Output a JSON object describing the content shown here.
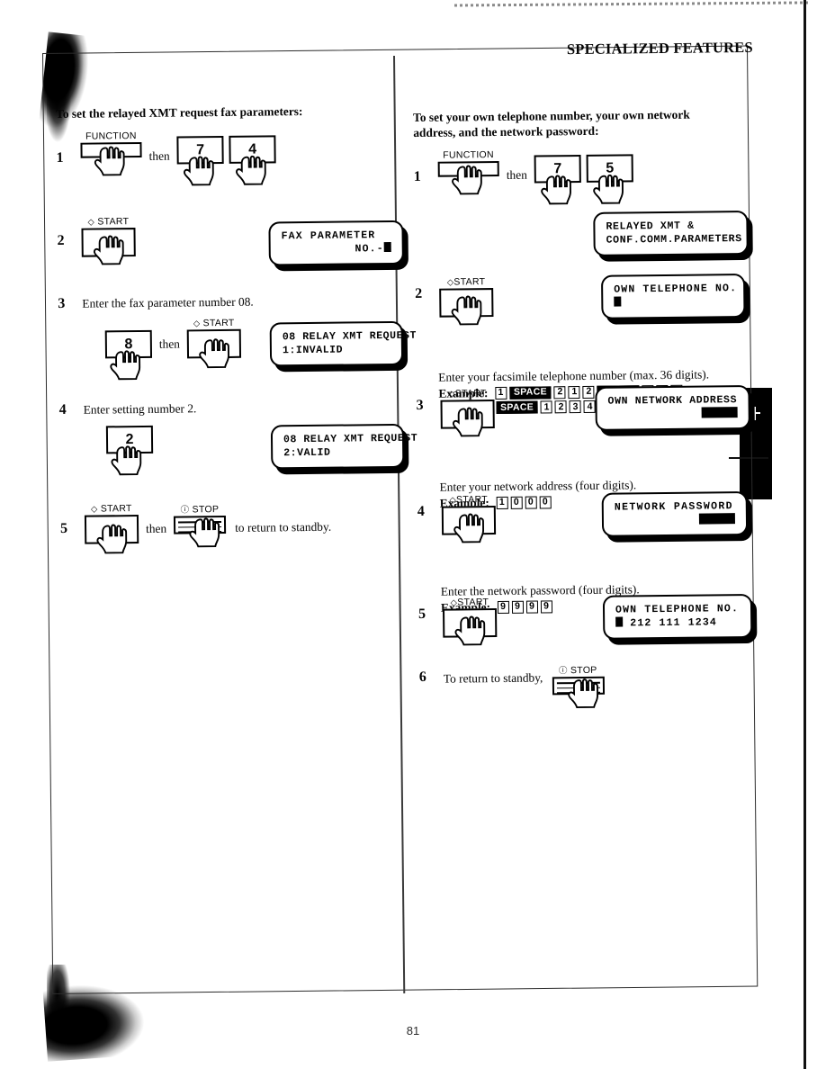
{
  "header": {
    "title": "SPECIALIZED FEATURES"
  },
  "footer": {
    "page_number": "81"
  },
  "left_column": {
    "intro": "To set the relayed XMT request fax parameters:",
    "steps": [
      {
        "num": "1",
        "keys": [
          {
            "cap": "FUNCTION",
            "label": ""
          },
          {
            "cap": "",
            "label": "7"
          },
          {
            "cap": "",
            "label": "4"
          }
        ],
        "then_label": "then"
      },
      {
        "num": "2",
        "start_cap": "START",
        "display": {
          "line1": "FAX PARAMETER",
          "line2": "NO.-"
        }
      },
      {
        "num": "3",
        "text": "Enter the fax parameter number 08.",
        "digit": "8",
        "then_label": "then",
        "start_cap": "START",
        "display": {
          "line1": "08 RELAY XMT REQUEST",
          "line2": "1:INVALID"
        }
      },
      {
        "num": "4",
        "text": "Enter setting number 2.",
        "digit": "2",
        "display": {
          "line1": "08 RELAY XMT REQUEST",
          "line2": "2:VALID"
        }
      },
      {
        "num": "5",
        "start_cap": "START",
        "then_label": "then",
        "stop_cap": "STOP",
        "trailing_text": "to return to standby."
      }
    ]
  },
  "right_column": {
    "intro": "To set your own telephone number, your own network address, and the network password:",
    "steps": [
      {
        "num": "1",
        "keys": [
          {
            "cap": "FUNCTION",
            "label": ""
          },
          {
            "cap": "",
            "label": "7"
          },
          {
            "cap": "",
            "label": "5"
          }
        ],
        "then_label": "then",
        "display": {
          "line1": "RELAYED XMT &",
          "line2": "CONF.COMM.PARAMETERS"
        }
      },
      {
        "num": "2",
        "start_cap": "START",
        "display": {
          "line1": "OWN TELEPHONE NO.",
          "line2": ""
        },
        "text": "Enter your facsimile telephone number (max. 36 digits).",
        "example_label": "Example:",
        "example_keys_row1": [
          "1",
          "SPACE",
          "2",
          "1",
          "2",
          "SPACE",
          "1",
          "1",
          "1"
        ],
        "example_keys_row2": [
          "SPACE",
          "1",
          "2",
          "3",
          "4"
        ]
      },
      {
        "num": "3",
        "start_cap": "START",
        "display": {
          "line1": "OWN NETWORK ADDRESS",
          "line2": ""
        },
        "text": "Enter your network address (four digits).",
        "example_label": "Example:",
        "example_keys_row1": [
          "1",
          "0",
          "0",
          "0"
        ]
      },
      {
        "num": "4",
        "start_cap": "START",
        "display": {
          "line1": "NETWORK PASSWORD",
          "line2": ""
        },
        "text": "Enter the network password (four digits).",
        "example_label": "Example:",
        "example_keys_row1": [
          "9",
          "9",
          "9",
          "9"
        ]
      },
      {
        "num": "5",
        "start_cap": "START",
        "display": {
          "line1": "OWN TELEPHONE NO.",
          "line2": "212 111 1234"
        }
      },
      {
        "num": "6",
        "text": "To return to standby,",
        "stop_cap": "STOP"
      }
    ]
  }
}
